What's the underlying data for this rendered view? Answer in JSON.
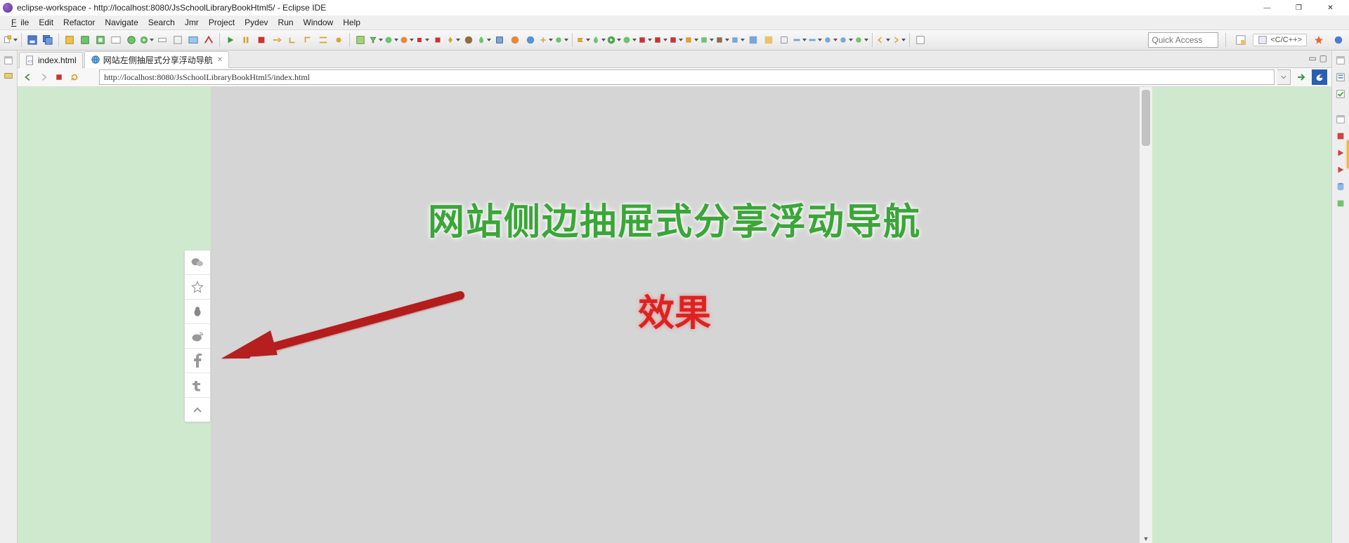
{
  "titlebar": {
    "text": "eclipse-workspace - http://localhost:8080/JsSchoolLibraryBookHtml5/ - Eclipse IDE"
  },
  "win": {
    "min": "—",
    "max": "❐",
    "close": "✕"
  },
  "menu": [
    "File",
    "Edit",
    "Refactor",
    "Navigate",
    "Search",
    "Jmr",
    "Project",
    "Pydev",
    "Run",
    "Window",
    "Help"
  ],
  "toolbar": {
    "quick_access_placeholder": "Quick Access",
    "perspective": "<C/C++>"
  },
  "tabs": [
    {
      "label": "index.html",
      "active": false,
      "icon": "html"
    },
    {
      "label": "网站左侧抽屉式分享浮动导航",
      "active": true,
      "icon": "globe"
    }
  ],
  "tab_close": "✕",
  "browser": {
    "url": "http://localhost:8080/JsSchoolLibraryBookHtml5/index.html"
  },
  "page": {
    "headline": "网站侧边抽屉式分享浮动导航",
    "sub": "效果"
  },
  "share_icons": [
    "wechat",
    "star",
    "qq",
    "weibo",
    "facebook",
    "twitter",
    "up"
  ],
  "left_trim_icons": [
    "restore",
    "variables"
  ],
  "right_trim_icons": [
    "outline",
    "task",
    "breakpoints",
    "red-sq",
    "red-tri",
    "red-tri",
    "blue-db",
    "green-sq",
    "highlight"
  ]
}
